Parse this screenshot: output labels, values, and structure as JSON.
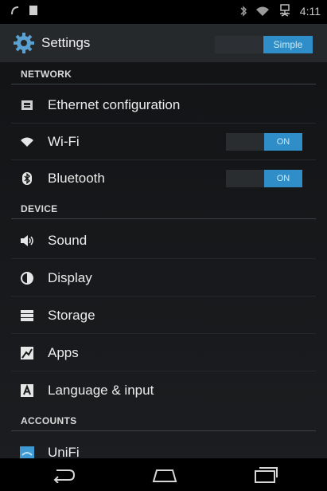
{
  "status_bar": {
    "time": "4:11",
    "left_icons": [
      "signal-hook-icon",
      "battery-square-icon"
    ],
    "right_icons": [
      "bluetooth-icon",
      "wifi-icon",
      "network-icon"
    ]
  },
  "action_bar": {
    "title": "Settings",
    "mode_button": "Simple",
    "icon": "settings-gear-icon",
    "accent": "#2f8ec8"
  },
  "sections": {
    "network": "NETWORK",
    "device": "DEVICE",
    "accounts": "ACCOUNTS"
  },
  "items": {
    "ethernet": {
      "label": "Ethernet configuration",
      "icon": "ethernet-icon"
    },
    "wifi": {
      "label": "Wi-Fi",
      "icon": "wifi-icon",
      "toggle": "ON"
    },
    "bluetooth": {
      "label": "Bluetooth",
      "icon": "bluetooth-icon",
      "toggle": "ON"
    },
    "sound": {
      "label": "Sound",
      "icon": "speaker-icon"
    },
    "display": {
      "label": "Display",
      "icon": "brightness-icon"
    },
    "storage": {
      "label": "Storage",
      "icon": "storage-icon"
    },
    "apps": {
      "label": "Apps",
      "icon": "apps-icon"
    },
    "language": {
      "label": "Language & input",
      "icon": "language-icon"
    },
    "unifi": {
      "label": "UniFi",
      "icon": "unifi-icon"
    }
  },
  "nav_bar": {
    "back": "back-icon",
    "home": "home-icon",
    "recents": "recents-icon"
  }
}
